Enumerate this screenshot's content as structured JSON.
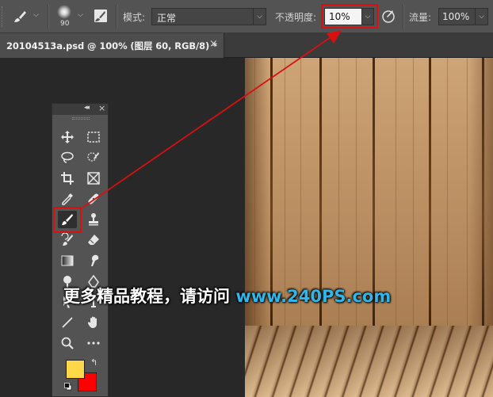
{
  "options_bar": {
    "brush_size": "90",
    "mode_label": "模式:",
    "mode_value": "正常",
    "opacity_label": "不透明度:",
    "opacity_value": "10%",
    "flow_label": "流量:",
    "flow_value": "100%"
  },
  "document_tab": {
    "title": "20104513a.psd @ 100% (图层 60, RGB/8) *",
    "close": "×"
  },
  "tools_panel": {
    "collapse": "◂◂",
    "close": "×",
    "tools": [
      {
        "name": "move-tool-icon"
      },
      {
        "name": "marquee-tool-icon"
      },
      {
        "name": "lasso-tool-icon"
      },
      {
        "name": "quick-selection-tool-icon"
      },
      {
        "name": "crop-tool-icon"
      },
      {
        "name": "frame-tool-icon"
      },
      {
        "name": "eyedropper-tool-icon"
      },
      {
        "name": "healing-brush-tool-icon"
      },
      {
        "name": "brush-tool-icon"
      },
      {
        "name": "clone-stamp-tool-icon"
      },
      {
        "name": "history-brush-tool-icon"
      },
      {
        "name": "eraser-tool-icon"
      },
      {
        "name": "gradient-tool-icon"
      },
      {
        "name": "smudge-tool-icon"
      },
      {
        "name": "line-tool-icon"
      },
      {
        "name": "hand-tool-icon"
      },
      {
        "name": "zoom-tool-icon"
      },
      {
        "name": "more-tools-icon"
      }
    ],
    "foreground_color": "#ffd84a",
    "background_color": "#ff0000"
  },
  "colors": {
    "highlight": "#d91010",
    "watermark_url": "#2fb6ea"
  },
  "watermark": {
    "text": "更多精品教程，请访问 ",
    "url": "www.240PS.com"
  }
}
